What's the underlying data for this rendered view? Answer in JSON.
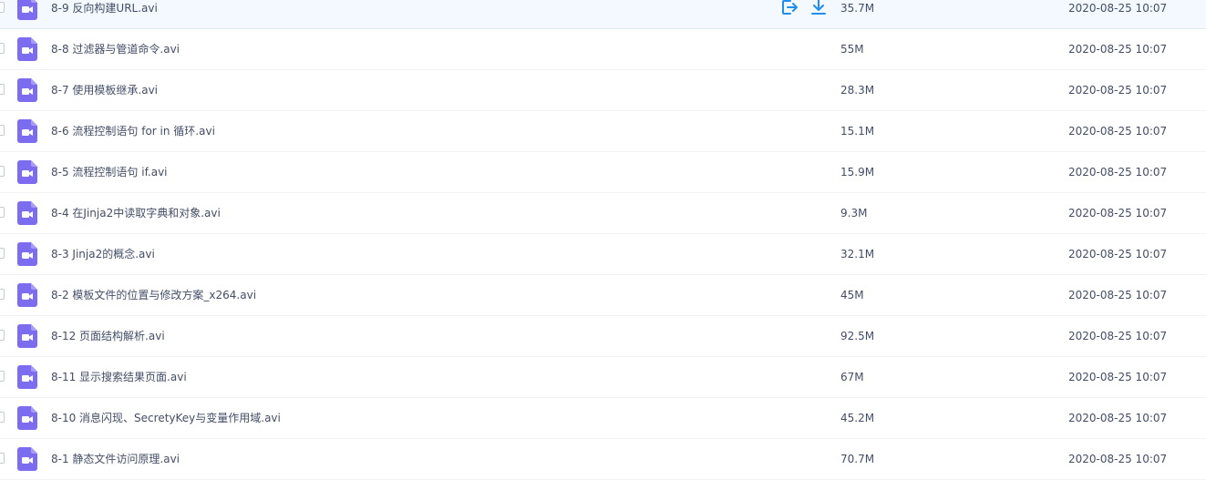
{
  "files": [
    {
      "name": "8-9 反向构建URL.avi",
      "size": "35.7M",
      "modified": "2020-08-25 10:07"
    },
    {
      "name": "8-8 过滤器与管道命令.avi",
      "size": "55M",
      "modified": "2020-08-25 10:07"
    },
    {
      "name": "8-7 使用模板继承.avi",
      "size": "28.3M",
      "modified": "2020-08-25 10:07"
    },
    {
      "name": "8-6 流程控制语句 for in 循环.avi",
      "size": "15.1M",
      "modified": "2020-08-25 10:07"
    },
    {
      "name": "8-5 流程控制语句 if.avi",
      "size": "15.9M",
      "modified": "2020-08-25 10:07"
    },
    {
      "name": "8-4 在Jinja2中读取字典和对象.avi",
      "size": "9.3M",
      "modified": "2020-08-25 10:07"
    },
    {
      "name": "8-3 Jinja2的概念.avi",
      "size": "32.1M",
      "modified": "2020-08-25 10:07"
    },
    {
      "name": "8-2 模板文件的位置与修改方案_x264.avi",
      "size": "45M",
      "modified": "2020-08-25 10:07"
    },
    {
      "name": "8-12 页面结构解析.avi",
      "size": "92.5M",
      "modified": "2020-08-25 10:07"
    },
    {
      "name": "8-11 显示搜索结果页面.avi",
      "size": "67M",
      "modified": "2020-08-25 10:07"
    },
    {
      "name": "8-10 消息闪现、SecretyKey与变量作用域.avi",
      "size": "45.2M",
      "modified": "2020-08-25 10:07"
    },
    {
      "name": "8-1 静态文件访问原理.avi",
      "size": "70.7M",
      "modified": "2020-08-25 10:07"
    }
  ],
  "hover_actions": [
    {
      "icon": "share-icon"
    },
    {
      "icon": "download-icon"
    }
  ],
  "colors": {
    "file_icon": "#7b6cf0",
    "action_icon": "#1e8ff0",
    "text": "#424e67",
    "hover_row": "#f3f9fe"
  }
}
